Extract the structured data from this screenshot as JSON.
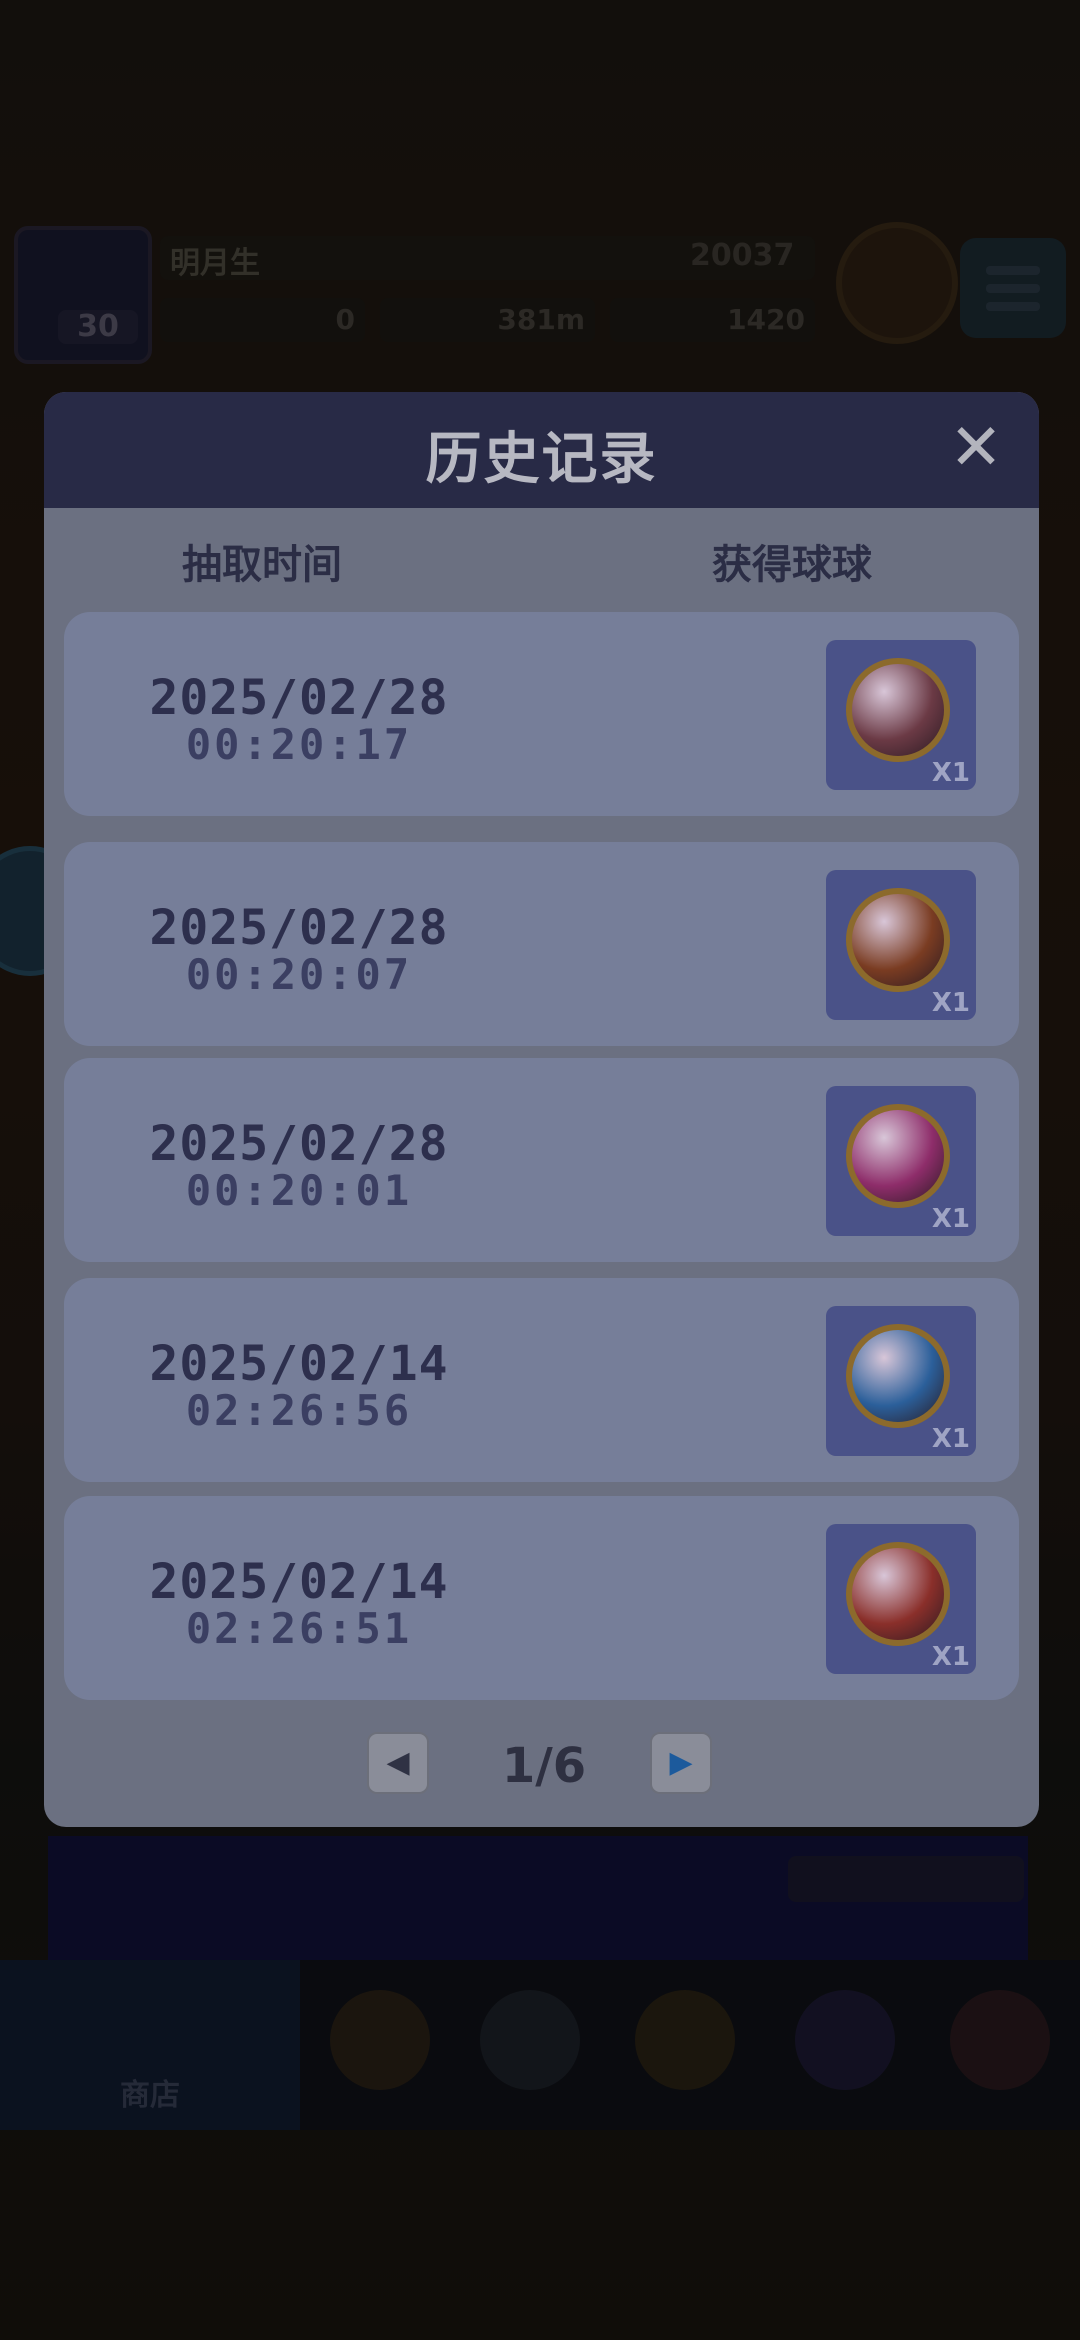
{
  "background": {
    "player_name": "明月生",
    "coins": "20037",
    "level": "30",
    "stat_a": "0",
    "stat_b": "381m",
    "stat_c": "1420",
    "nav_shop_label": "商店"
  },
  "dialog": {
    "title": "历史记录",
    "close_symbol": "✕",
    "col_time": "抽取时间",
    "col_reward": "获得球球",
    "records": [
      {
        "date": "2025/02/28",
        "time": "00:20:17",
        "qty": "X1",
        "icon": "skull-ball-icon",
        "color": "#6b3a45"
      },
      {
        "date": "2025/02/28",
        "time": "00:20:07",
        "qty": "X1",
        "icon": "infinity-ball-icon",
        "color": "#7a3c22"
      },
      {
        "date": "2025/02/28",
        "time": "00:20:01",
        "qty": "X1",
        "icon": "blade-ball-icon",
        "color": "#8e2d6a"
      },
      {
        "date": "2025/02/14",
        "time": "02:26:56",
        "qty": "X1",
        "icon": "ice-ball-icon",
        "color": "#2b5f9a"
      },
      {
        "date": "2025/02/14",
        "time": "02:26:51",
        "qty": "X1",
        "icon": "fist-ball-icon",
        "color": "#8a2f2a"
      }
    ],
    "pager": {
      "text": "1/6",
      "prev_symbol": "◀",
      "next_symbol": "▶"
    }
  }
}
